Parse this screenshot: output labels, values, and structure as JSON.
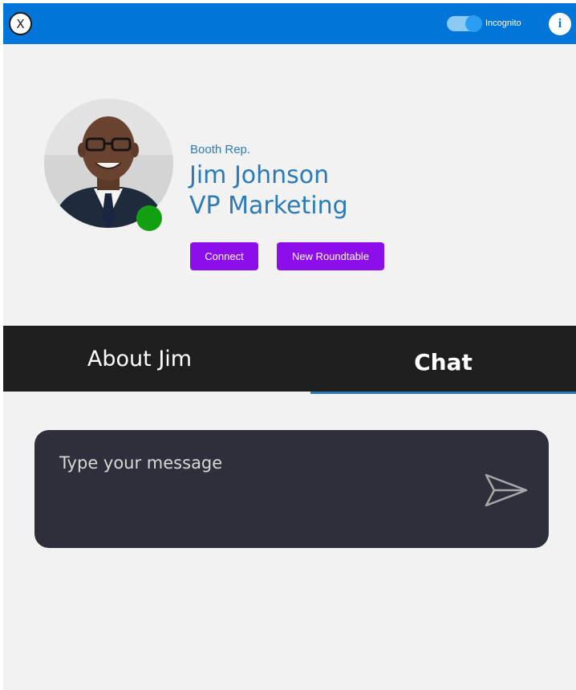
{
  "topbar": {
    "close_label": "X",
    "incognito_label": "Incognito",
    "incognito_on": true,
    "info_label": "i",
    "bar_color": "#0276d8"
  },
  "profile": {
    "role_label": "Booth Rep.",
    "name": "Jim Johnson",
    "title": "VP Marketing",
    "status": "online",
    "status_color": "#12a012",
    "text_color": "#2b7bb9"
  },
  "actions": {
    "connect_label": "Connect",
    "roundtable_label": "New Roundtable",
    "button_color": "#8e0eeb"
  },
  "tabs": {
    "items": [
      {
        "label": "About Jim",
        "active": false
      },
      {
        "label": "Chat",
        "active": true
      }
    ]
  },
  "chat": {
    "placeholder": "Type your message",
    "value": "",
    "send_icon": "send-icon"
  }
}
